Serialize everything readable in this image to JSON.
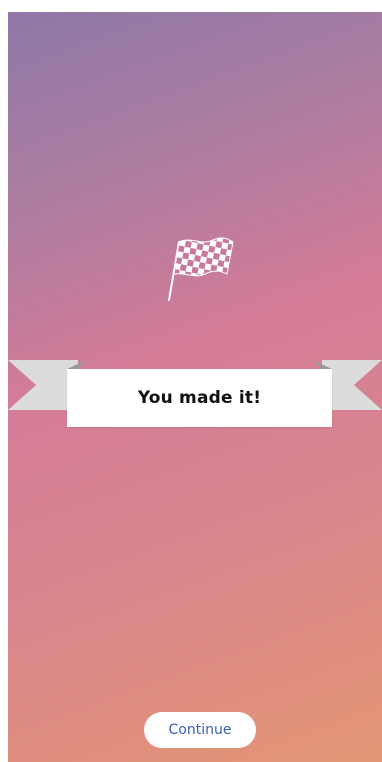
{
  "celebration": {
    "icon": "checkered-flag-icon",
    "message": "You made it!"
  },
  "actions": {
    "continue_label": "Continue"
  },
  "colors": {
    "gradient_top": "#8e78a8",
    "gradient_mid": "#d57c97",
    "gradient_bottom": "#e39674",
    "banner": "#ffffff",
    "banner_tail": "#d9d9d9",
    "button_text": "#3a5fb0"
  }
}
